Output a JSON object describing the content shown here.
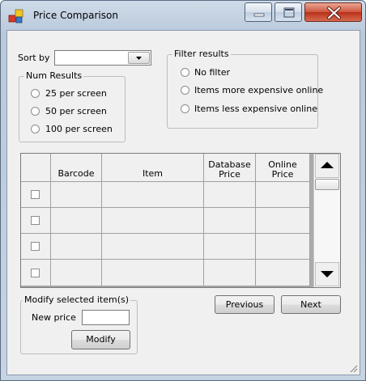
{
  "window": {
    "title": "Price Comparison",
    "icon": "app-icon",
    "controls": [
      "minimize-icon",
      "maximize-icon",
      "close-icon"
    ]
  },
  "sort": {
    "label": "Sort by",
    "selected": ""
  },
  "num_results": {
    "title": "Num Results",
    "options": [
      "25 per screen",
      "50 per screen",
      "100 per screen"
    ]
  },
  "filter": {
    "title": "Filter results",
    "options": [
      "No filter",
      "Items more expensive online",
      "Items less expensive online"
    ]
  },
  "grid": {
    "columns": [
      "",
      "Barcode",
      "Item",
      "Database Price",
      "Online Price"
    ],
    "rows": [
      {
        "checked": false,
        "barcode": "",
        "item": "",
        "db_price": "",
        "online_price": ""
      },
      {
        "checked": false,
        "barcode": "",
        "item": "",
        "db_price": "",
        "online_price": ""
      },
      {
        "checked": false,
        "barcode": "",
        "item": "",
        "db_price": "",
        "online_price": ""
      },
      {
        "checked": false,
        "barcode": "",
        "item": "",
        "db_price": "",
        "online_price": ""
      }
    ],
    "scroll_icons": [
      "scroll-up-icon",
      "scroll-down-icon"
    ]
  },
  "modify": {
    "title": "Modify selected item(s)",
    "new_price_label": "New price",
    "new_price_value": "",
    "button": "Modify"
  },
  "pager": {
    "previous": "Previous",
    "next": "Next"
  },
  "colors": {
    "title_gradient_top": "#cfdbe8",
    "close_button": "#c74a32",
    "client_bg": "#f0f0f0"
  }
}
